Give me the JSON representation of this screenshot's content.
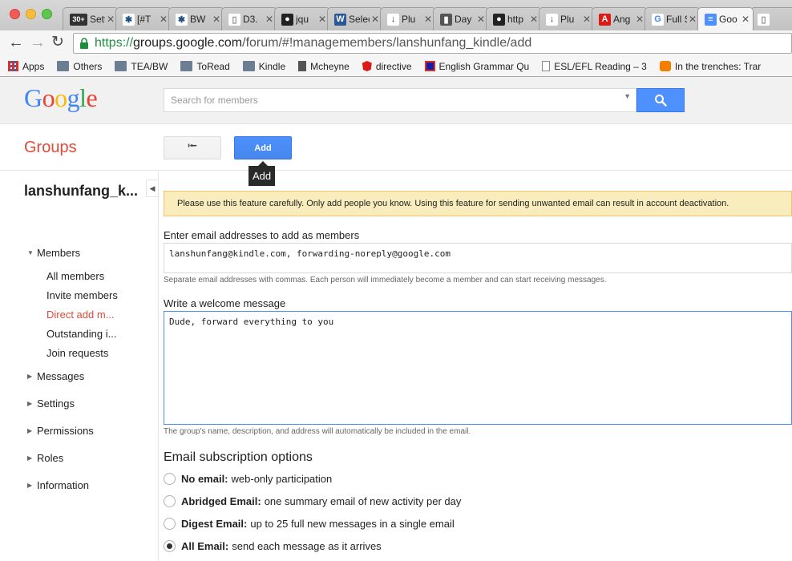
{
  "browser": {
    "tabs": [
      {
        "title": "Settings",
        "icon": "gmail-icon",
        "badge": "30+"
      },
      {
        "title": "[#T",
        "icon": "jira-icon"
      },
      {
        "title": "BW",
        "icon": "jira-icon"
      },
      {
        "title": "D3.",
        "icon": "page-icon"
      },
      {
        "title": "jqu",
        "icon": "github-icon"
      },
      {
        "title": "Selecto",
        "icon": "w3schools-icon"
      },
      {
        "title": "Plu",
        "icon": "download-icon"
      },
      {
        "title": "Day",
        "icon": "book-icon"
      },
      {
        "title": "http",
        "icon": "github-icon"
      },
      {
        "title": "Plu",
        "icon": "download-icon"
      },
      {
        "title": "Ang",
        "icon": "angular-icon"
      },
      {
        "title": "Full Sp",
        "icon": "google-icon"
      },
      {
        "title": "Goo",
        "icon": "groups-icon"
      },
      {
        "title": "",
        "icon": "page-icon"
      }
    ],
    "url_scheme": "https://",
    "url_host": "groups.google.com",
    "url_path": "/forum/#!managemembers/lanshunfang_kindle/add",
    "bookmarks": [
      {
        "label": "Apps",
        "icon": "apps-grid-icon"
      },
      {
        "label": "Others",
        "icon": "folder-icon"
      },
      {
        "label": "TEA/BW",
        "icon": "folder-icon"
      },
      {
        "label": "ToRead",
        "icon": "folder-icon"
      },
      {
        "label": "Kindle",
        "icon": "folder-icon"
      },
      {
        "label": "Mcheyne",
        "icon": "book-icon"
      },
      {
        "label": "directive",
        "icon": "angular-icon"
      },
      {
        "label": "English Grammar Qu",
        "icon": "square-icon"
      },
      {
        "label": "ESL/EFL Reading – 3",
        "icon": "page-icon"
      },
      {
        "label": "In the trenches: Trar",
        "icon": "blogger-icon"
      }
    ]
  },
  "header": {
    "logo_letters": [
      "G",
      "o",
      "o",
      "g",
      "l",
      "e"
    ],
    "search_placeholder": "Search for members"
  },
  "groups_bar": {
    "title": "Groups",
    "back_glyph": "⭰",
    "add_label": "Add",
    "tooltip": "Add"
  },
  "sidebar": {
    "group_name": "lanshunfang_k...",
    "collapse_glyph": "◀",
    "members_label": "Members",
    "member_items": [
      "All members",
      "Invite members",
      "Direct add m...",
      "Outstanding i...",
      "Join requests"
    ],
    "sections": [
      "Messages",
      "Settings",
      "Permissions",
      "Roles",
      "Information"
    ]
  },
  "main": {
    "warning": "Please use this feature carefully. Only add people you know. Using this feature for sending unwanted email can result in account deactivation.",
    "emails_label": "Enter email addresses to add as members",
    "emails_value": "lanshunfang@kindle.com, forwarding-noreply@google.com",
    "emails_hint": "Separate email addresses with commas. Each person will immediately become a member and can start receiving messages.",
    "welcome_label": "Write a welcome message",
    "welcome_value": "Dude, forward everything to you",
    "welcome_hint": "The group's name, description, and address will automatically be included in the email.",
    "subscription_title": "Email subscription options",
    "options": [
      {
        "title": "No email:",
        "desc": "web-only participation",
        "selected": false
      },
      {
        "title": "Abridged Email:",
        "desc": "one summary email of new activity per day",
        "selected": false
      },
      {
        "title": "Digest Email:",
        "desc": "up to 25 full new messages in a single email",
        "selected": false
      },
      {
        "title": "All Email:",
        "desc": "send each message as it arrives",
        "selected": true
      }
    ]
  },
  "colors": {
    "brand_red": "#dd4b39",
    "primary_blue": "#4d90fe",
    "warning_bg": "#f9edbe"
  }
}
